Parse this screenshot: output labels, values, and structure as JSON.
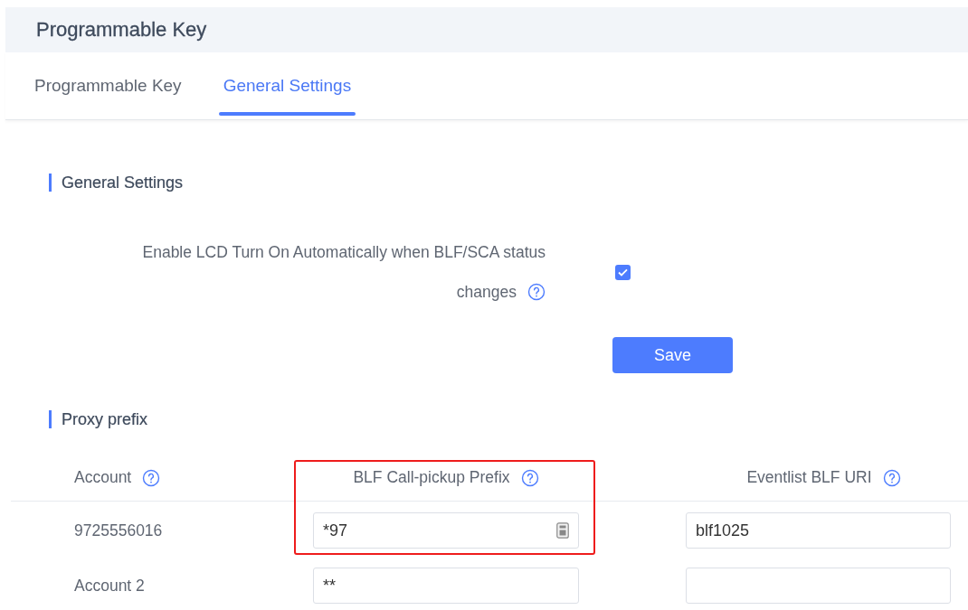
{
  "header": {
    "title": "Programmable Key"
  },
  "tabs": [
    {
      "label": "Programmable Key",
      "selected": false
    },
    {
      "label": "General Settings",
      "selected": true
    }
  ],
  "general_settings": {
    "heading": "General Settings",
    "option": {
      "label_line_1": "Enable LCD Turn On Automatically when BLF/SCA status",
      "label_line_2": "changes",
      "checked": true
    },
    "save_button": "Save"
  },
  "proxy_prefix": {
    "heading": "Proxy prefix",
    "columns": [
      {
        "label": "Account",
        "highlighted": false
      },
      {
        "label": "BLF Call-pickup Prefix",
        "highlighted": true
      },
      {
        "label": "Eventlist BLF URI",
        "highlighted": false
      }
    ],
    "rows": [
      {
        "account": "9725556016",
        "call_pickup_prefix": "*97",
        "eventlist_blf_uri": "blf1025",
        "focused_field": true
      },
      {
        "account": "Account 2",
        "call_pickup_prefix": "**",
        "focused_field": false
      }
    ]
  }
}
